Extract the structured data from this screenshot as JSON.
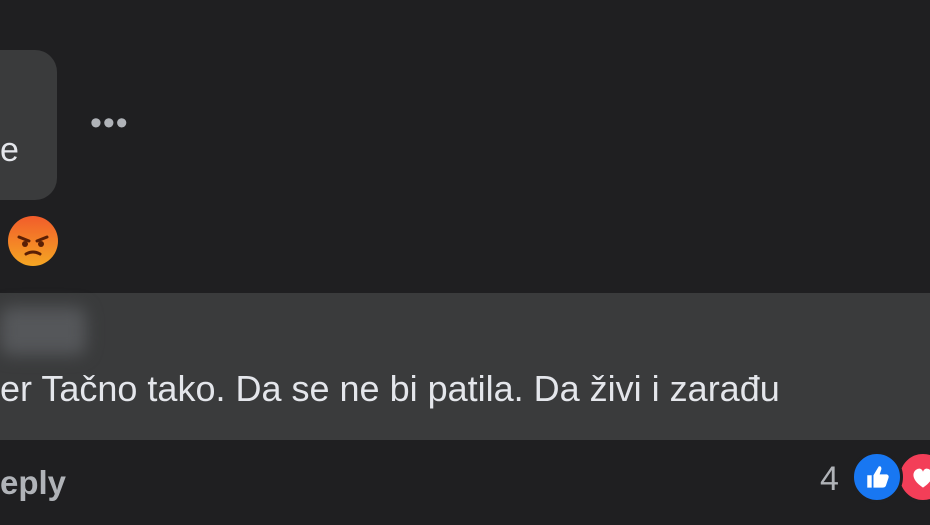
{
  "top_comment": {
    "text_fragment": "e",
    "more_label": "•••",
    "reaction_icon": "angry-face-icon"
  },
  "reply_comment": {
    "text": "er Tačno tako. Da se ne bi patila. Da živi i zarađu",
    "reply_label": "eply",
    "reaction_count": "4",
    "reaction_icons": [
      "like-icon",
      "love-icon"
    ]
  },
  "colors": {
    "background": "#1f1f21",
    "bubble": "#3a3b3c",
    "text": "#e4e6eb",
    "muted": "#b0b3b8",
    "like": "#1877f2",
    "love": "#f33e58",
    "angry": "#f25c2b"
  }
}
